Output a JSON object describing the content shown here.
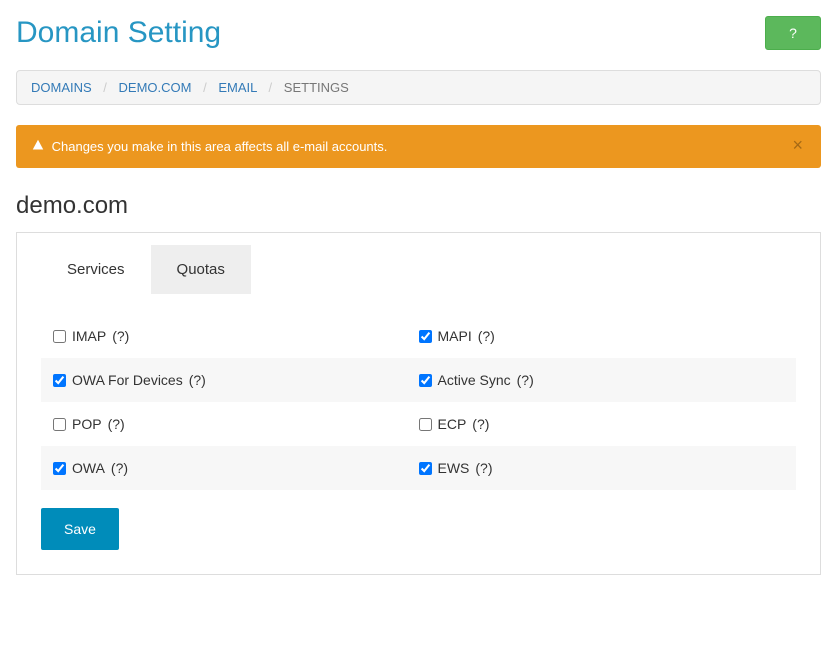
{
  "header": {
    "title": "Domain Setting",
    "help_label": "?"
  },
  "breadcrumb": {
    "domains": "DOMAINS",
    "domain": "DEMO.COM",
    "email": "EMAIL",
    "settings": "SETTINGS"
  },
  "alert": {
    "text": "Changes you make in this area affects all e-mail accounts."
  },
  "domain": {
    "name": "demo.com"
  },
  "tabs": {
    "services": "Services",
    "quotas": "Quotas"
  },
  "services": {
    "imap": {
      "label": "IMAP",
      "help": "(?)",
      "checked": false
    },
    "mapi": {
      "label": "MAPI",
      "help": "(?)",
      "checked": true
    },
    "owa_dev": {
      "label": "OWA For Devices",
      "help": "(?)",
      "checked": true
    },
    "activesync": {
      "label": "Active Sync",
      "help": "(?)",
      "checked": true
    },
    "pop": {
      "label": "POP",
      "help": "(?)",
      "checked": false
    },
    "ecp": {
      "label": "ECP",
      "help": "(?)",
      "checked": false
    },
    "owa": {
      "label": "OWA",
      "help": "(?)",
      "checked": true
    },
    "ews": {
      "label": "EWS",
      "help": "(?)",
      "checked": true
    }
  },
  "actions": {
    "save": "Save"
  }
}
